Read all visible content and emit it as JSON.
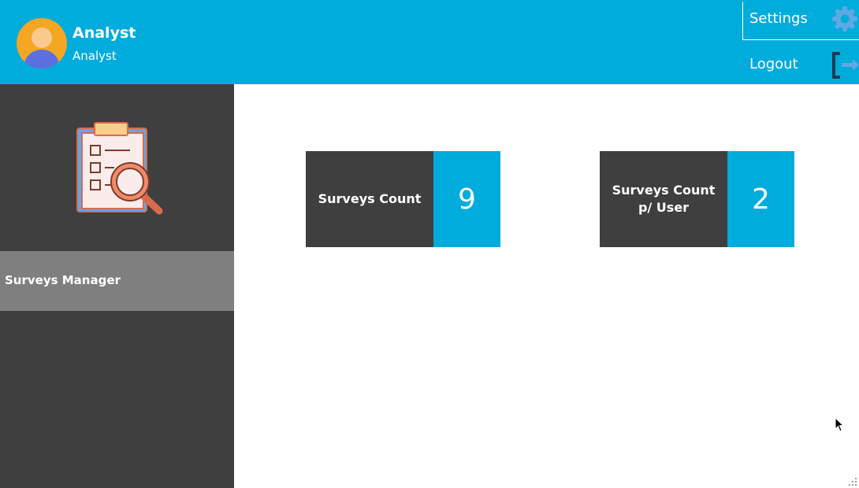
{
  "header": {
    "user_name": "Analyst",
    "user_role": "Analyst",
    "settings_label": "Settings",
    "logout_label": "Logout",
    "avatar_icon": "user-avatar-icon",
    "settings_icon": "gear-icon",
    "logout_icon": "logout-icon"
  },
  "sidebar": {
    "logo_icon": "clipboard-search-icon",
    "items": [
      {
        "label": "Surveys Manager"
      }
    ]
  },
  "cards": [
    {
      "label": "Surveys Count",
      "value": "9"
    },
    {
      "label": "Surveys Count p/ User",
      "value": "2"
    }
  ],
  "colors": {
    "accent": "#00acdb",
    "dark": "#3f3f3f",
    "nav_active": "#7f7f7f"
  }
}
